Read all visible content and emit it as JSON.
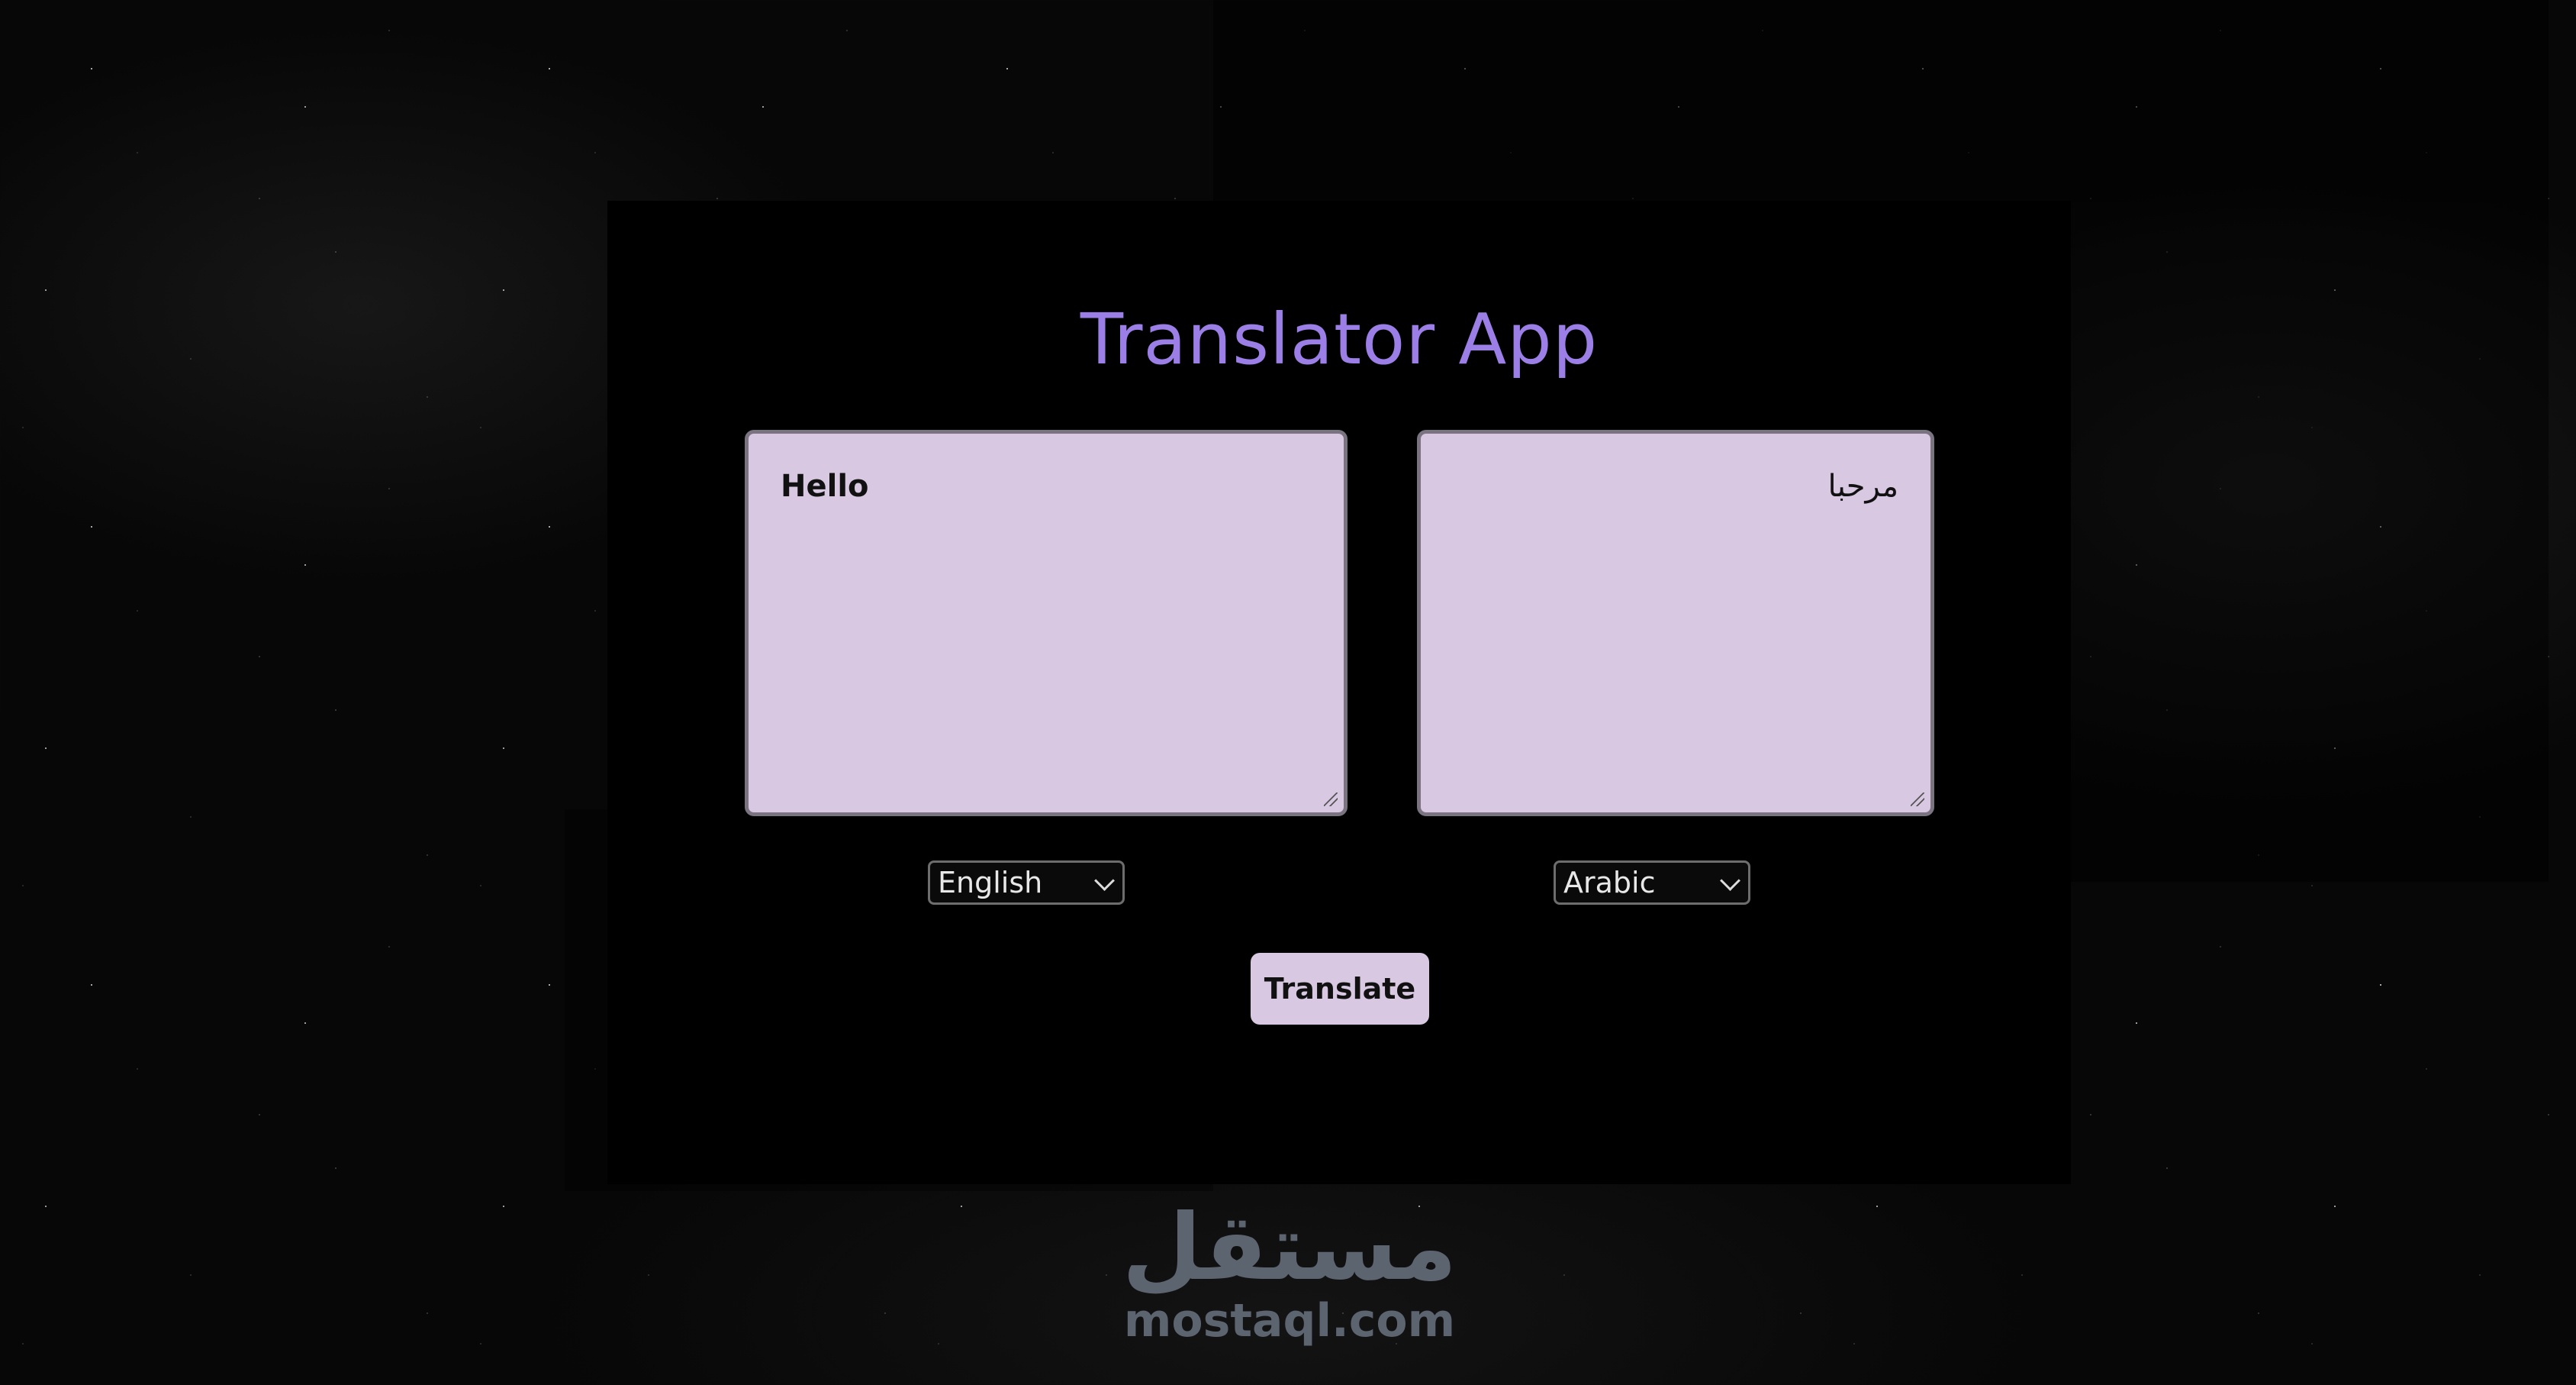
{
  "app": {
    "title": "Translator App"
  },
  "source": {
    "text": "Hello",
    "language": "English"
  },
  "target": {
    "text": "مرحبا",
    "language": "Arabic"
  },
  "actions": {
    "translate_label": "Translate"
  },
  "watermark": {
    "arabic": "مستقل",
    "latin": "mostaql.com"
  },
  "icons": {
    "select_arrow": "chevron-down-icon",
    "resize_handle": "resize-grip-icon"
  },
  "colors": {
    "title": "#9b7fe6",
    "textbox_background": "#d8c8e2",
    "button_background": "#d8c8e2",
    "card_background": "#000000",
    "watermark": "#5c6470"
  }
}
